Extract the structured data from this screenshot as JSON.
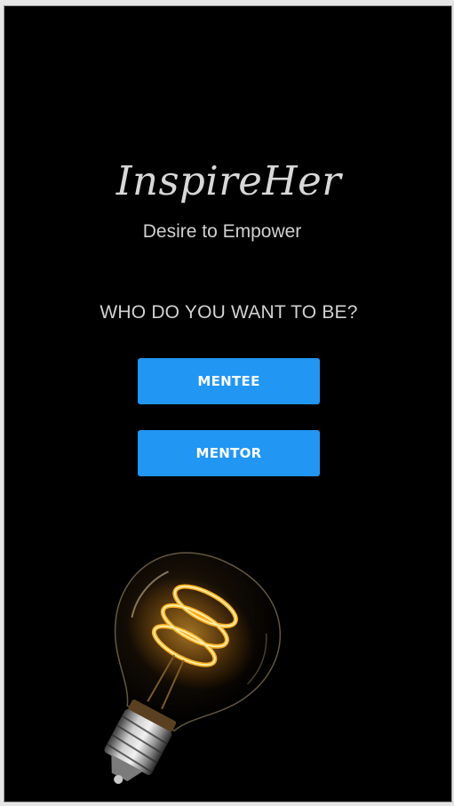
{
  "app": {
    "title": "InspireHer",
    "tagline": "Desire to Empower"
  },
  "role_select": {
    "question": "WHO DO YOU WANT TO BE?",
    "mentee_label": "MENTEE",
    "mentor_label": "MENTOR"
  },
  "illustration": {
    "icon": "light-bulb"
  },
  "colors": {
    "background": "#000000",
    "accent": "#2196f3",
    "text": "#d2d2d2"
  }
}
